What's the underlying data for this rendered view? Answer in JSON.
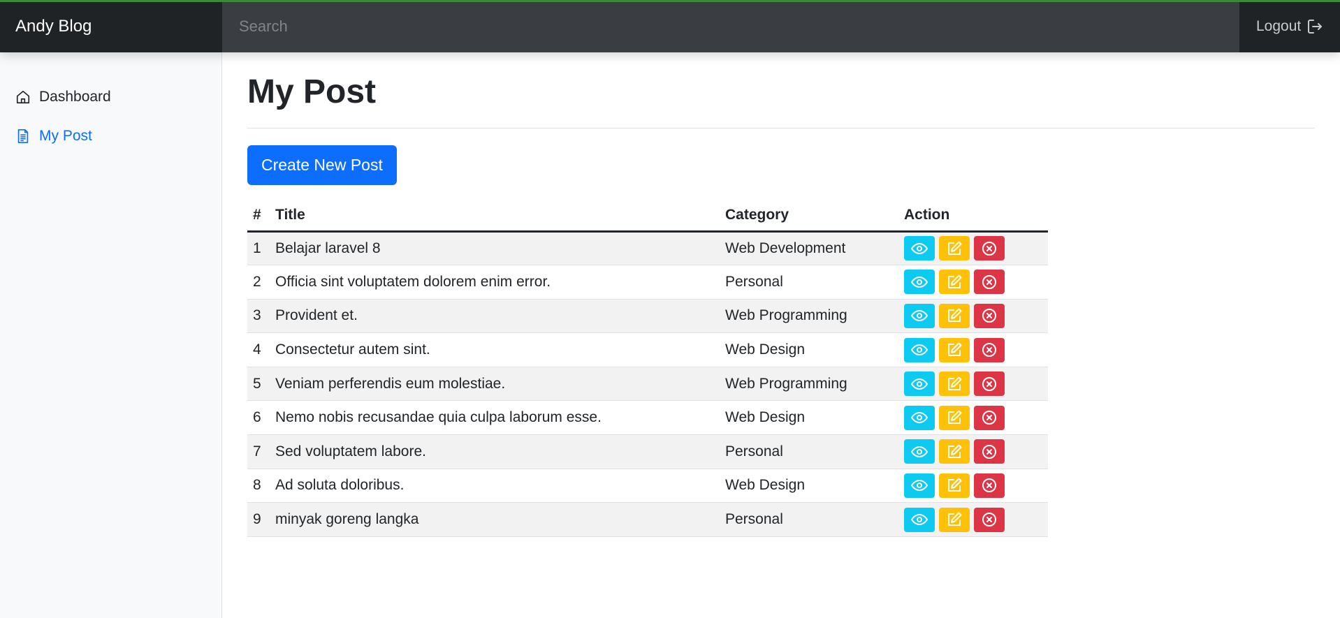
{
  "navbar": {
    "brand": "Andy Blog",
    "search_placeholder": "Search",
    "logout_label": "Logout"
  },
  "sidebar": {
    "items": [
      {
        "label": "Dashboard",
        "icon": "home-icon",
        "active": false
      },
      {
        "label": "My Post",
        "icon": "file-text-icon",
        "active": true
      }
    ]
  },
  "main": {
    "title": "My Post",
    "create_button": "Create New Post",
    "table": {
      "headers": [
        "#",
        "Title",
        "Category",
        "Action"
      ],
      "rows": [
        {
          "num": "1",
          "title": "Belajar laravel 8",
          "category": "Web Development"
        },
        {
          "num": "2",
          "title": "Officia sint voluptatem dolorem enim error.",
          "category": "Personal"
        },
        {
          "num": "3",
          "title": "Provident et.",
          "category": "Web Programming"
        },
        {
          "num": "4",
          "title": "Consectetur autem sint.",
          "category": "Web Design"
        },
        {
          "num": "5",
          "title": "Veniam perferendis eum molestiae.",
          "category": "Web Programming"
        },
        {
          "num": "6",
          "title": "Nemo nobis recusandae quia culpa laborum esse.",
          "category": "Web Design"
        },
        {
          "num": "7",
          "title": "Sed voluptatem labore.",
          "category": "Personal"
        },
        {
          "num": "8",
          "title": "Ad soluta doloribus.",
          "category": "Web Design"
        },
        {
          "num": "9",
          "title": "minyak goreng langka",
          "category": "Personal"
        }
      ]
    }
  },
  "colors": {
    "primary": "#0d6efd",
    "info": "#0dcaf0",
    "warning": "#ffc107",
    "danger": "#dc3545",
    "navbar": "#343a40"
  }
}
